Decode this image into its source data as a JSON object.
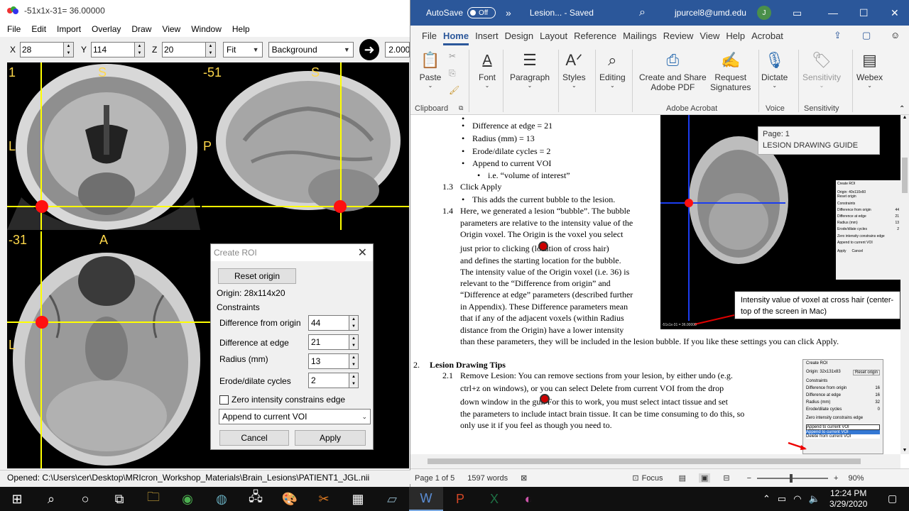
{
  "mricron": {
    "title": "-51x1x-31= 36.00000",
    "menu": [
      "File",
      "Edit",
      "Import",
      "Overlay",
      "Draw",
      "View",
      "Window",
      "Help"
    ],
    "coords": {
      "x_label": "X",
      "x": "28",
      "y_label": "Y",
      "y": "114",
      "z_label": "Z",
      "z": "20"
    },
    "zoom": "Fit",
    "layer": "Background",
    "contrast": "2.000",
    "views": {
      "coronal": {
        "slice": "1",
        "top": "S",
        "left": "L"
      },
      "sagittal": {
        "slice": "-51",
        "top": "S",
        "left": "P"
      },
      "axial": {
        "slice": "-31",
        "top": "A",
        "left": "L"
      }
    },
    "status": "Opened: C:\\Users\\cer\\Desktop\\MRIcron_Workshop_Materials\\Brain_Lesions\\PATIENT1_JGL.nii"
  },
  "roi_dialog": {
    "title": "Create ROI",
    "reset_label": "Reset origin",
    "origin": "Origin: 28x114x20",
    "constraints": "Constraints",
    "fields": [
      {
        "label": "Difference from origin",
        "value": "44"
      },
      {
        "label": "Difference at edge",
        "value": "21"
      },
      {
        "label": "Radius (mm)",
        "value": "13"
      },
      {
        "label": "Erode/dilate cycles",
        "value": "2"
      }
    ],
    "zero_label": "Zero intensity constrains edge",
    "mode": "Append to current VOI",
    "cancel": "Cancel",
    "apply": "Apply"
  },
  "word": {
    "autosave": "AutoSave",
    "autosave_state": "Off",
    "doc_title": "Lesion... - Saved",
    "user": "jpurcel8@umd.edu",
    "user_initial": "J",
    "tabs": [
      "File",
      "Home",
      "Insert",
      "Design",
      "Layout",
      "Reference",
      "Mailings",
      "Review",
      "View",
      "Help",
      "Acrobat"
    ],
    "active_tab": "Home",
    "ribbon": {
      "paste": "Paste",
      "font": "Font",
      "paragraph": "Paragraph",
      "styles": "Styles",
      "editing": "Editing",
      "create_share": "Create and Share",
      "adobe_pdf": "Adobe PDF",
      "request": "Request",
      "signatures": "Signatures",
      "dictate": "Dictate",
      "sensitivity": "Sensitivity",
      "webex": "Webex",
      "groups": {
        "clipboard": "Clipboard",
        "adobe": "Adobe Acrobat",
        "voice": "Voice",
        "sensitivity": "Sensitivity"
      }
    },
    "doc": {
      "bullets": [
        "Difference at edge = 21",
        "Radius (mm) = 13",
        "Erode/dilate cycles = 2",
        "Append to current VOI"
      ],
      "sub_bullet": "i.e. “volume of interest”",
      "s13": "1.3",
      "s13_text": "Click Apply",
      "s13_bullet": "This adds the current bubble to the lesion.",
      "s14": "1.4",
      "s14_lines": [
        "Here, we generated a lesion “bubble”. The bubble",
        "parameters are relative to the intensity value of the",
        "Origin  voxel. The Origin is the voxel you select",
        "just prior to clicking     (location of cross hair)",
        "and defines the starting location for the bubble.",
        "The intensity value of the Origin voxel (i.e. 36) is",
        "relevant to the “Difference from origin” and",
        "“Difference at edge” parameters (described further",
        "in Appendix). These Difference parameters mean",
        "that if any of the adjacent voxels (within Radius",
        "distance from the Origin) have a lower intensity",
        "than these parameters, they will be included in the lesion bubble. If you like these settings you can click Apply."
      ],
      "s2": "2.",
      "s2_title": "Lesion Drawing Tips",
      "s21": "2.1",
      "s21_lines": [
        "Remove Lesion: You can remove sections from your lesion, by either undo (e.g.",
        "ctrl+z on windows), or you can select Delete from current VOI from the drop",
        "down window in the     gui. For this to work, you must select intact tissue and set",
        "the parameters to include intact brain tissue. It can be time consuming to do this, so",
        "only use it if you feel as though you need to."
      ],
      "tooltip_page": "Page: 1",
      "tooltip_title": "LESION DRAWING GUIDE",
      "callout": "Intensity value of voxel at cross hair (center-top of the screen in Mac)",
      "thumb_caption": "-51x1x-31 = 36.00000",
      "mini_roi": {
        "title": "Create ROI",
        "origin": "Origin: 40x110x60",
        "reset": "Reset origin",
        "constraints": "Constraints",
        "rows": [
          [
            "Difference from origin",
            "44"
          ],
          [
            "Difference at edge",
            "21"
          ],
          [
            "Radius (mm)",
            "13"
          ],
          [
            "Erode/dilate cycles",
            "2"
          ]
        ],
        "zero": "Zero intensity constrains edge",
        "mode": "Append to current VOI",
        "apply": "Apply",
        "cancel": "Cancel"
      },
      "mini_roi2": {
        "title": "Create ROI",
        "origin": "Origin: 32x131x83",
        "reset": "Reset origin",
        "constraints": "Constraints",
        "rows": [
          [
            "Difference from origin",
            "16"
          ],
          [
            "Difference at edge",
            "16"
          ],
          [
            "Radius (mm)",
            "32"
          ],
          [
            "Erode/dilate cycles",
            "0"
          ]
        ],
        "zero": "Zero intensity constrains edge",
        "opt1": "Append to current VOI",
        "opt2": "Append to current VOI",
        "opt3": "Delete from current VOI"
      }
    },
    "status": {
      "page": "Page 1 of 5",
      "words": "1597 words",
      "focus": "Focus",
      "zoom": "90%"
    }
  },
  "taskbar": {
    "time": "12:24 PM",
    "date": "3/29/2020"
  }
}
